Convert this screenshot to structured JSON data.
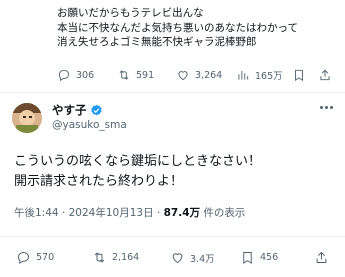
{
  "quoted": {
    "lines": [
      "お願いだからもうテレビ出んな",
      "本当に不快なんだよ気持ち悪いのあなたはわかって",
      "消え失せろよゴミ無能不快ギャラ泥棒野郎"
    ],
    "stats": {
      "replies": "306",
      "reposts": "591",
      "likes": "3,264",
      "views": "165万"
    }
  },
  "post": {
    "display_name": "やす子",
    "handle": "@yasuko_sma",
    "lines": [
      "こういうの呟くなら鍵垢にしときなさい！",
      "開示請求されたら終わりよ！"
    ],
    "time": "午後1:44",
    "date": "2024年10月13日",
    "views_count": "87.4万",
    "views_label": "件の表示",
    "stats": {
      "replies": "570",
      "reposts": "2,164",
      "likes": "3.4万",
      "bookmarks": "456"
    },
    "colors": {
      "verified": "#1d9bf0",
      "muted": "#536471"
    }
  }
}
